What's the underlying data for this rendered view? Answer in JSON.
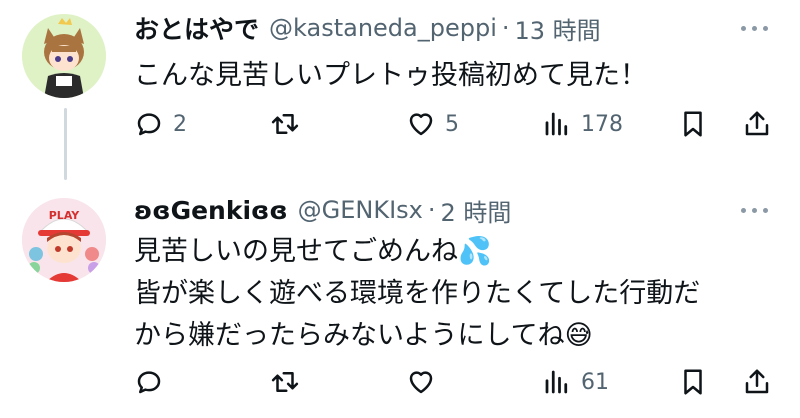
{
  "tweets": [
    {
      "name": "おとはやで",
      "handle": "@kastaneda_peppi",
      "separator": "·",
      "time": "13 時間",
      "text_lines": [
        "こんな見苦しいプレトゥ投稿初めて見た！"
      ],
      "avatar_icon": "cat-ear-character-avatar",
      "actions": {
        "reply": "2",
        "retweet": "",
        "like": "5",
        "views": "178"
      }
    },
    {
      "name": "ʚɞGenkiɞɞ",
      "handle": "@GENKIsx",
      "separator": "·",
      "time": "2 時間",
      "text_lines": [
        "見苦しいの見せてごめんね💦",
        "皆が楽しく遊べる環境を作りたくてした行動だ",
        "から嫌だったらみないようにしてね😅"
      ],
      "avatar_icon": "play-cap-character-avatar",
      "avatar_text": "PLAY",
      "actions": {
        "reply": "",
        "retweet": "",
        "like": "",
        "views": "61"
      }
    }
  ],
  "colors": {
    "text": "#0f1419",
    "secondary": "#536471",
    "thread_line": "#cfd9de"
  }
}
